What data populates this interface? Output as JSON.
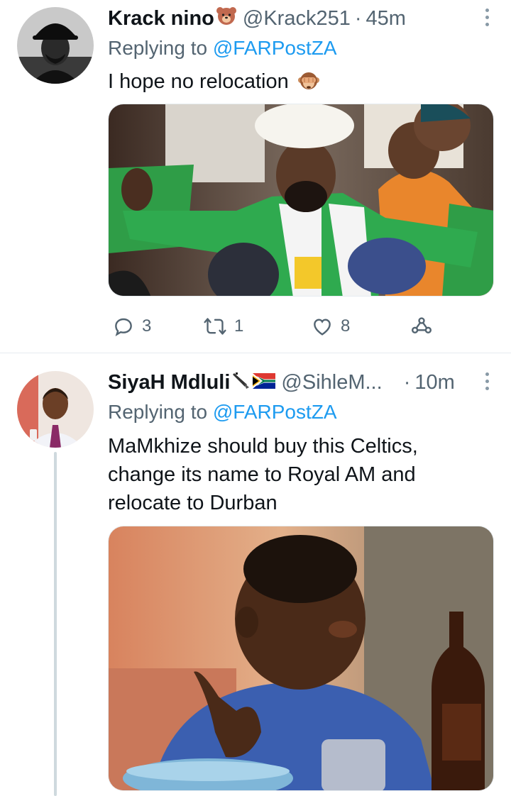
{
  "tweets": [
    {
      "name": "Krack nino",
      "badge_icon": "bear-face-icon",
      "handle": "@Krack251",
      "dot": "·",
      "time": "45m",
      "replying_prefix": "Replying to ",
      "replying_to": "@FARPostZA",
      "text": "I hope no relocation",
      "text_emoji": "see-no-evil-monkey-icon",
      "reply_count": "3",
      "retweet_count": "1",
      "like_count": "8"
    },
    {
      "name": "SiyaH Mdluli",
      "badge_icons": [
        "vuvuzela-icon",
        "south-africa-flag-icon"
      ],
      "handle": "@SihleM...",
      "dot": "·",
      "time": "10m",
      "replying_prefix": "Replying to ",
      "replying_to": "@FARPostZA",
      "text": "MaMkhize should buy this Celtics, change its name to Royal AM and relocate to Durban"
    }
  ],
  "colors": {
    "link": "#1d9bf0",
    "secondary_text": "#536471",
    "primary_text": "#0f1419",
    "thread_line": "#cfd9de"
  }
}
